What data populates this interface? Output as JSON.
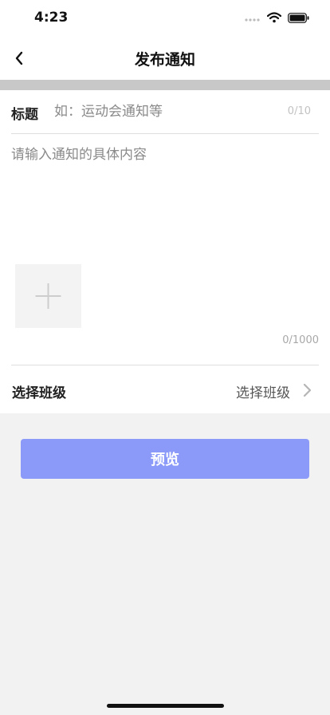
{
  "status_bar": {
    "time": "4:23"
  },
  "nav": {
    "title": "发布通知",
    "back_icon": "chevron-left-icon"
  },
  "form": {
    "title_label": "标题",
    "title_placeholder": "如：运动会通知等",
    "title_value": "",
    "title_count": "0/10",
    "content_placeholder": "请输入通知的具体内容",
    "content_value": "",
    "add_image_icon": "plus-icon",
    "content_count": "0/1000",
    "class_label": "选择班级",
    "class_value": "选择班级",
    "class_icon": "chevron-right-icon"
  },
  "actions": {
    "preview_label": "预览"
  },
  "colors": {
    "accent": "#8b9af8",
    "page_bg": "#f2f2f2",
    "divider_band": "#c8c8c8"
  }
}
